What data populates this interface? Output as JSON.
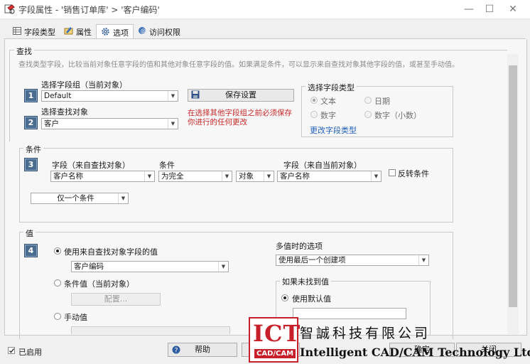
{
  "window": {
    "title": "字段属性 - '销售订单库' > '客户编码'",
    "min_icon": "minimize-icon",
    "max_icon": "maximize-icon",
    "close_icon": "close-icon"
  },
  "tabs": [
    {
      "label": "字段类型",
      "icon": "table-icon"
    },
    {
      "label": "属性",
      "icon": "properties-icon"
    },
    {
      "label": "选项",
      "icon": "gear-icon",
      "active": true
    },
    {
      "label": "访问权限",
      "icon": "access-icon"
    }
  ],
  "lookup": {
    "group_label": "查找",
    "description": "查找类型字段，比较当前对象任意字段的值和其他对象任意字段的值。如果满足条件，可以显示来自查找对象其他字段的值，或甚至手动值。",
    "field_group_label": "选择字段组（当前对象）",
    "field_group_value": "Default",
    "lookup_object_label": "选择查找对象",
    "lookup_object_value": "客户",
    "save_button": "保存设置",
    "warning": "在选择其他字段组之前必须保存你进行的任何更改",
    "field_type": {
      "label": "选择字段类型",
      "options": [
        "文本",
        "日期",
        "数字",
        "数字（小数）"
      ],
      "selected": "文本",
      "change_link": "更改字段类型"
    }
  },
  "conditions": {
    "group_label": "条件",
    "col_lookup_field": "字段（来自查找对象）",
    "col_condition": "条件",
    "col_current_field": "字段（来自当前对象）",
    "lookup_field_value": "客户名称",
    "condition_value": "为完全",
    "target_value": "对象",
    "current_field_value": "客户名称",
    "invert_label": "反转条件",
    "mode_value": "仅一个条件"
  },
  "value": {
    "group_label": "值",
    "use_lookup_label": "使用来自查找对象字段的值",
    "lookup_field_value": "客户编码",
    "conditional_label": "条件值（当前对象）",
    "configure_button": "配置...",
    "manual_label": "手动值",
    "multi_label": "多值时的选项",
    "multi_value": "使用最后一个创建项",
    "not_found_label": "如果未找到值",
    "use_default_label": "使用默认值",
    "default_value": ""
  },
  "steps": [
    "1",
    "2",
    "3",
    "4"
  ],
  "footer": {
    "enabled_label": "已启用",
    "help_button": "帮助",
    "ok_button": "确定",
    "cancel_button": "关闭"
  },
  "watermark": {
    "logo_top": "ICT",
    "logo_bottom": "CAD/CAM",
    "company_cn": "智誠科技有限公司",
    "company_en": "Intelligent CAD/CAM Technology Ltd."
  },
  "colors": {
    "step_badge": "#4a6c8e",
    "warning": "#c62828",
    "link": "#1f5fb8",
    "brand_red": "#c8202a"
  }
}
